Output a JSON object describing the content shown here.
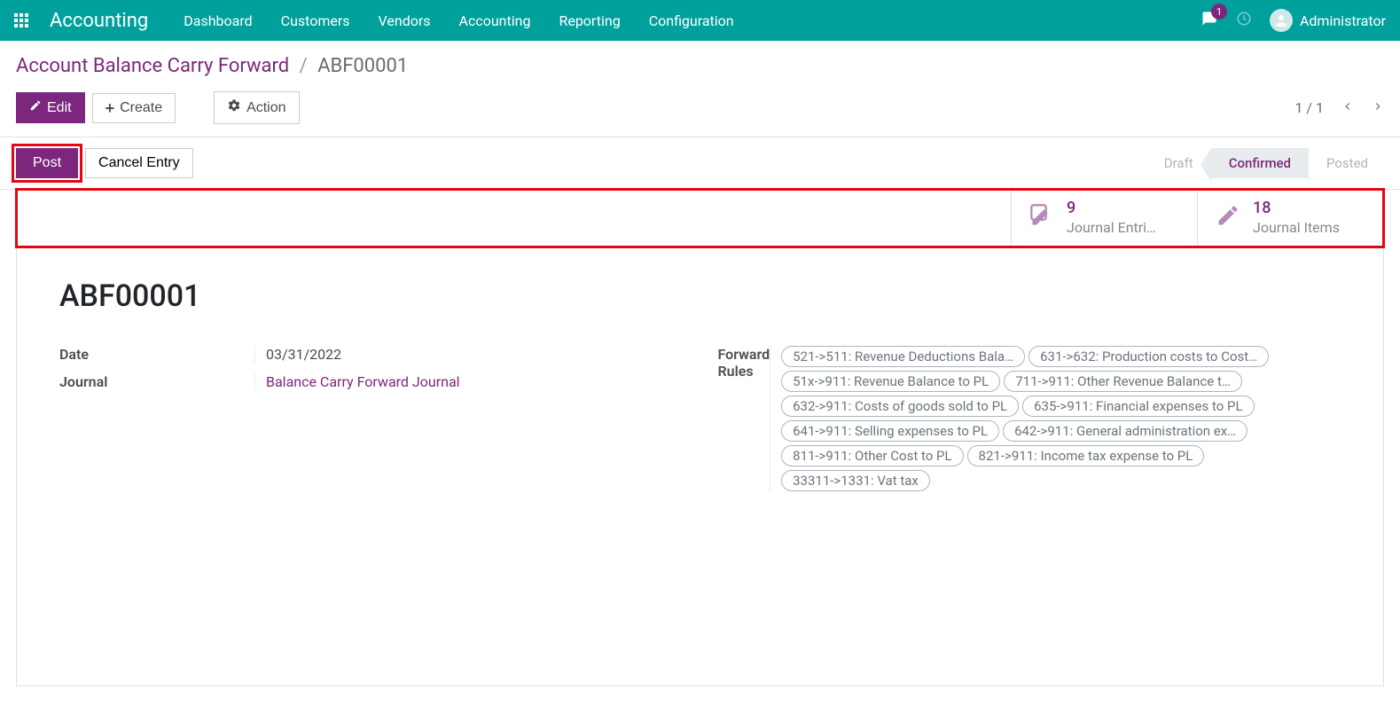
{
  "topbar": {
    "app_name": "Accounting",
    "nav": [
      "Dashboard",
      "Customers",
      "Vendors",
      "Accounting",
      "Reporting",
      "Configuration"
    ],
    "msg_count": "1",
    "user": "Administrator"
  },
  "breadcrumb": {
    "parent": "Account Balance Carry Forward",
    "current": "ABF00001"
  },
  "buttons": {
    "edit": "Edit",
    "create": "Create",
    "action": "Action",
    "post": "Post",
    "cancel_entry": "Cancel Entry"
  },
  "pager": {
    "text": "1 / 1"
  },
  "status_steps": {
    "draft": "Draft",
    "confirmed": "Confirmed",
    "posted": "Posted"
  },
  "stats": {
    "entries_count": "9",
    "entries_label": "Journal Entri…",
    "items_count": "18",
    "items_label": "Journal Items"
  },
  "record": {
    "title": "ABF00001",
    "labels": {
      "date": "Date",
      "journal": "Journal",
      "forward_rules": "Forward Rules"
    },
    "date": "03/31/2022",
    "journal": "Balance Carry Forward Journal",
    "rules": [
      "521->511: Revenue Deductions Bala…",
      "631->632: Production costs to Cost…",
      "51x->911: Revenue Balance to PL",
      "711->911: Other Revenue Balance t…",
      "632->911: Costs of goods sold to PL",
      "635->911: Financial expenses to PL",
      "641->911: Selling expenses to PL",
      "642->911: General administration ex…",
      "811->911: Other Cost to PL",
      "821->911: Income tax expense to PL",
      "33311->1331: Vat tax"
    ]
  }
}
